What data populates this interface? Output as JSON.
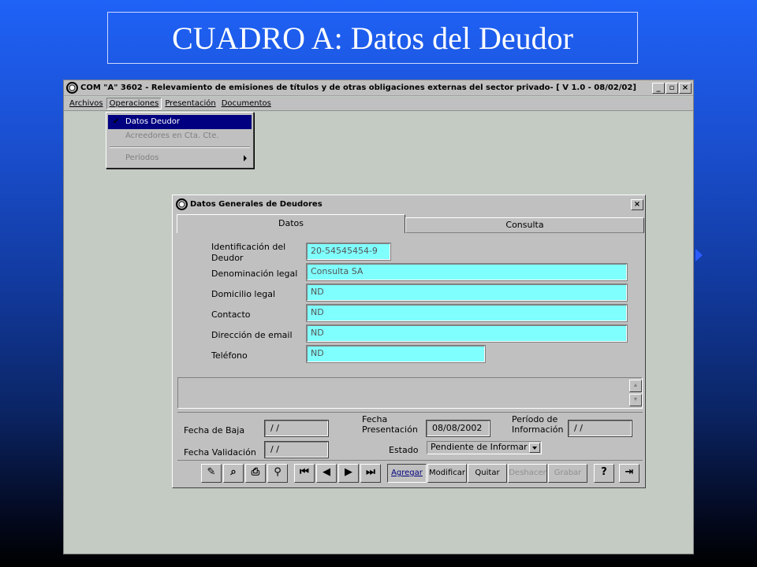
{
  "slide": {
    "title": "CUADRO A: Datos del Deudor"
  },
  "app": {
    "title": "COM \"A\" 3602 - Relevamiento de emisiones de títulos y de otras obligaciones externas del sector privado- [ V 1.0 - 08/02/02]",
    "window_buttons": [
      "_",
      "▫",
      "×"
    ],
    "menus": [
      "Archivos",
      "Operaciones",
      "Presentación",
      "Documentos"
    ],
    "dropdown": {
      "items": [
        {
          "label": "Datos Deudor",
          "checked": true
        },
        {
          "label": "Acreedores en Cta. Cte."
        },
        {
          "label": "Períodos"
        }
      ]
    }
  },
  "dialog": {
    "title": "Datos Generales de Deudores",
    "close": "×",
    "tabs": {
      "datos": "Datos",
      "consulta": "Consulta"
    },
    "fields": {
      "identificacion_label_1": "Identificación del",
      "identificacion_label_2": "Deudor",
      "identificacion_value": "20-54545454-9",
      "denominacion_label": "Denominación legal",
      "denominacion_value": "Consulta SA",
      "domicilio_label": "Domicilio legal",
      "domicilio_value": "ND",
      "contacto_label": "Contacto",
      "contacto_value": "ND",
      "email_label": "Dirección de email",
      "email_value": "ND",
      "telefono_label": "Teléfono",
      "telefono_value": "ND"
    },
    "lower": {
      "fecha_baja_label": "Fecha de Baja",
      "fecha_baja_value": "/ /",
      "fecha_validacion_label": "Fecha Validación",
      "fecha_validacion_value": "/ /",
      "fecha_presentacion_label_1": "Fecha",
      "fecha_presentacion_label_2": "Presentación",
      "fecha_presentacion_value": "08/08/2002",
      "estado_label": "Estado",
      "estado_value": "Pendiente de Informar",
      "periodo_label_1": "Período de",
      "periodo_label_2": "Información",
      "periodo_value": "/ /"
    },
    "toolbar": {
      "agregar": "Agregar",
      "modificar": "Modificar",
      "quitar": "Quitar",
      "deshacer": "Deshacer",
      "grabar": "Grabar",
      "help": "?"
    }
  }
}
